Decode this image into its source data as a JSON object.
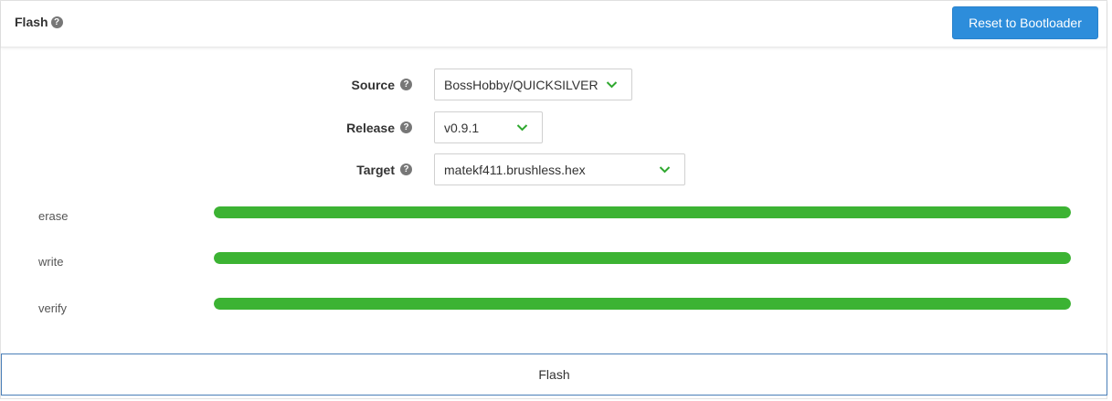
{
  "header": {
    "title": "Flash",
    "help_glyph": "?",
    "reset_label": "Reset to Bootloader"
  },
  "form": {
    "source": {
      "label": "Source",
      "help_glyph": "?",
      "value": "BossHobby/QUICKSILVER"
    },
    "release": {
      "label": "Release",
      "help_glyph": "?",
      "value": "v0.9.1"
    },
    "target": {
      "label": "Target",
      "help_glyph": "?",
      "value": "matekf411.brushless.hex"
    }
  },
  "progress": [
    {
      "label": "erase",
      "fraction": 1.0
    },
    {
      "label": "write",
      "fraction": 1.0
    },
    {
      "label": "verify",
      "fraction": 1.0
    }
  ],
  "flash_button": {
    "label": "Flash"
  },
  "colors": {
    "accent_blue": "#2d8ddb",
    "progress_green": "#3cb333",
    "chevron_green": "#2fa82f"
  },
  "icons": {
    "help": "question-circle-icon",
    "dropdown": "chevron-down-icon"
  }
}
